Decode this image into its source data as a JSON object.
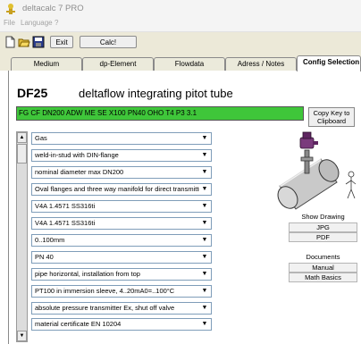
{
  "window": {
    "title": "deltacalc 7 PRO"
  },
  "menu": {
    "items": [
      "File",
      "Language",
      "?"
    ]
  },
  "toolbar": {
    "exit_label": "Exit",
    "calc_label": "Calc!"
  },
  "tabs": [
    {
      "label": "Medium",
      "active": false
    },
    {
      "label": "dp-Element",
      "active": false
    },
    {
      "label": "Flowdata",
      "active": false
    },
    {
      "label": "Adress / Notes",
      "active": false
    },
    {
      "label": "Config Selection",
      "active": true
    }
  ],
  "product": {
    "code": "DF25",
    "description": "deltaflow integrating pitot tube"
  },
  "order_key": "FG CF DN200 ADW ME SE X100 PN40 OHO T4 P3 3.1",
  "copy_key_label": [
    "Copy Key to",
    "Clipboard"
  ],
  "selections": [
    "Gas",
    "weld-in-stud with DIN-flange",
    "nominal diameter max DN200",
    "Oval flanges and three way manifold for direct transmitter mounting",
    "V4A 1.4571 SS316ti",
    "V4A 1.4571 SS316ti",
    "0..100mm",
    "PN 40",
    "pipe horizontal, installation from top",
    "PT100 in immersion sleeve, 4..20mA0=..100°C",
    "absolute pressure transmitter Ex, shut off valve",
    "material certificate EN 10204"
  ],
  "right_panel": {
    "show_drawing_label": "Show Drawing",
    "jpg_label": "JPG",
    "pdf_label": "PDF",
    "documents_label": "Documents",
    "manual_label": "Manual",
    "math_basics_label": "Math Basics"
  },
  "colors": {
    "key_bar": "#3fc63a",
    "tab_bg": "#ebeadb",
    "window_bg": "#ffffff"
  }
}
